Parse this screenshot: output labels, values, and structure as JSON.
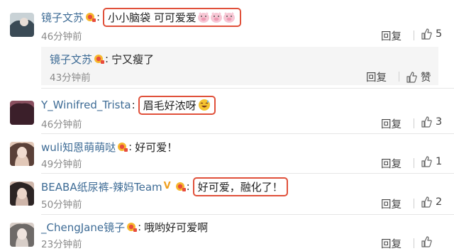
{
  "comments": [
    {
      "username": "镜子文苏",
      "text": "小小脑袋 可可爱爱",
      "emoji": [
        "pig-face",
        "pig-face",
        "pig-face"
      ],
      "time": "46分钟前",
      "reply_label": "回复",
      "likes": "5",
      "avatar_colors": [
        "#3a4a55",
        "#c9d2d6"
      ],
      "sub_reply": {
        "username": "镜子文苏",
        "text": "宁又瘦了",
        "time": "43分钟前",
        "reply_label": "回复",
        "like_label": "赞"
      }
    },
    {
      "username": "Y_Winifred_Trista",
      "text": "眉毛好浓呀",
      "emoji": [
        "sweat-laugh-face"
      ],
      "time": "46分钟前",
      "reply_label": "回复",
      "likes": "3",
      "avatar_colors": [
        "#3b1f2a",
        "#8a5060"
      ]
    },
    {
      "username": "wuli知恩萌萌哒",
      "text": "好可爱！",
      "time": "49分钟前",
      "reply_label": "回复",
      "likes": "1",
      "avatar_colors": [
        "#5a4038",
        "#e2c8b8"
      ]
    },
    {
      "username": "BEABA纸尿裤-辣妈Team",
      "text": "好可爱，融化了！",
      "time": "50分钟前",
      "reply_label": "回复",
      "likes": "2",
      "avatar_colors": [
        "#2c2424",
        "#cfb6aa"
      ]
    },
    {
      "username": "_ChengJane镜子",
      "text": "哦哟好可爱啊",
      "time": "23分钟前",
      "reply_label": "回复",
      "avatar_colors": [
        "#6e6a68",
        "#d8cec8"
      ]
    }
  ],
  "colors": {
    "username": "#3d6b95",
    "highlight_border": "#e0503a",
    "time": "#8a8a8a",
    "vip_badge": "#f0a020"
  }
}
